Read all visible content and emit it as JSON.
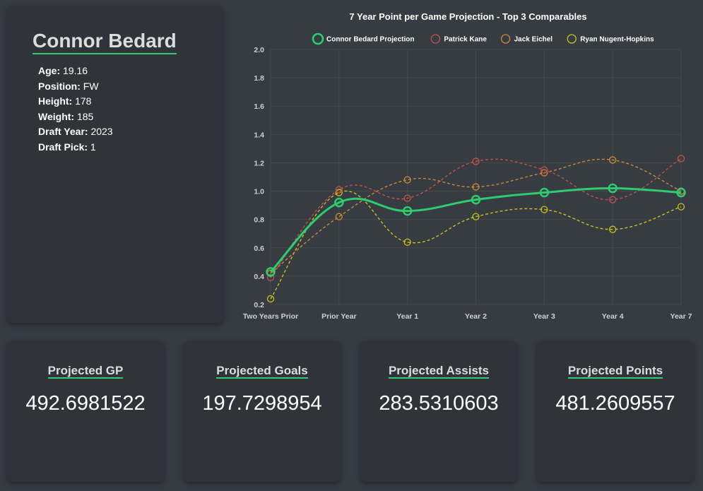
{
  "player": {
    "name": "Connor Bedard",
    "info": [
      {
        "label": "Age:",
        "value": "19.16"
      },
      {
        "label": "Position:",
        "value": "FW"
      },
      {
        "label": "Height:",
        "value": "178"
      },
      {
        "label": "Weight:",
        "value": "185"
      },
      {
        "label": "Draft Year:",
        "value": "2023"
      },
      {
        "label": "Draft Pick:",
        "value": "1"
      }
    ]
  },
  "stats": {
    "gp": {
      "label": "Projected GP",
      "value": "492.6981522"
    },
    "goals": {
      "label": "Projected Goals",
      "value": "197.7298954"
    },
    "assists": {
      "label": "Projected Assists",
      "value": "283.5310603"
    },
    "points": {
      "label": "Projected Points",
      "value": "481.2609557"
    }
  },
  "colors": {
    "accent": "#2ecc71",
    "background": "#373b42",
    "card": "#30343a"
  },
  "chart_data": {
    "type": "line",
    "title": "7 Year Point per Game Projection - Top 3 Comparables",
    "xlabel": "",
    "ylabel": "",
    "categories": [
      "Two Years Prior",
      "Prior Year",
      "Year 1",
      "Year 2",
      "Year 3",
      "Year 4",
      "Year 7"
    ],
    "ylim": [
      0.2,
      2.0
    ],
    "yticks": [
      "2.0",
      "1.8",
      "1.6",
      "1.4",
      "1.2",
      "1.0",
      "0.8",
      "0.6",
      "0.4",
      "0.2"
    ],
    "grid": true,
    "legend": "top",
    "series": [
      {
        "name": "Connor Bedard Projection",
        "color": "#2ecc71",
        "dashed": false,
        "values": [
          0.43,
          0.92,
          0.86,
          0.94,
          0.99,
          1.02,
          0.99
        ]
      },
      {
        "name": "Patrick Kane",
        "color": "#c0504d",
        "dashed": true,
        "values": [
          0.39,
          1.01,
          0.95,
          1.21,
          1.15,
          0.94,
          1.23
        ]
      },
      {
        "name": "Jack Eichel",
        "color": "#c88a3c",
        "dashed": true,
        "values": [
          0.42,
          0.82,
          1.08,
          1.03,
          1.13,
          1.22,
          1.0
        ]
      },
      {
        "name": "Ryan Nugent-Hopkins",
        "color": "#c8c01e",
        "dashed": true,
        "values": [
          0.24,
          0.99,
          0.64,
          0.82,
          0.87,
          0.73,
          0.89
        ]
      }
    ]
  }
}
